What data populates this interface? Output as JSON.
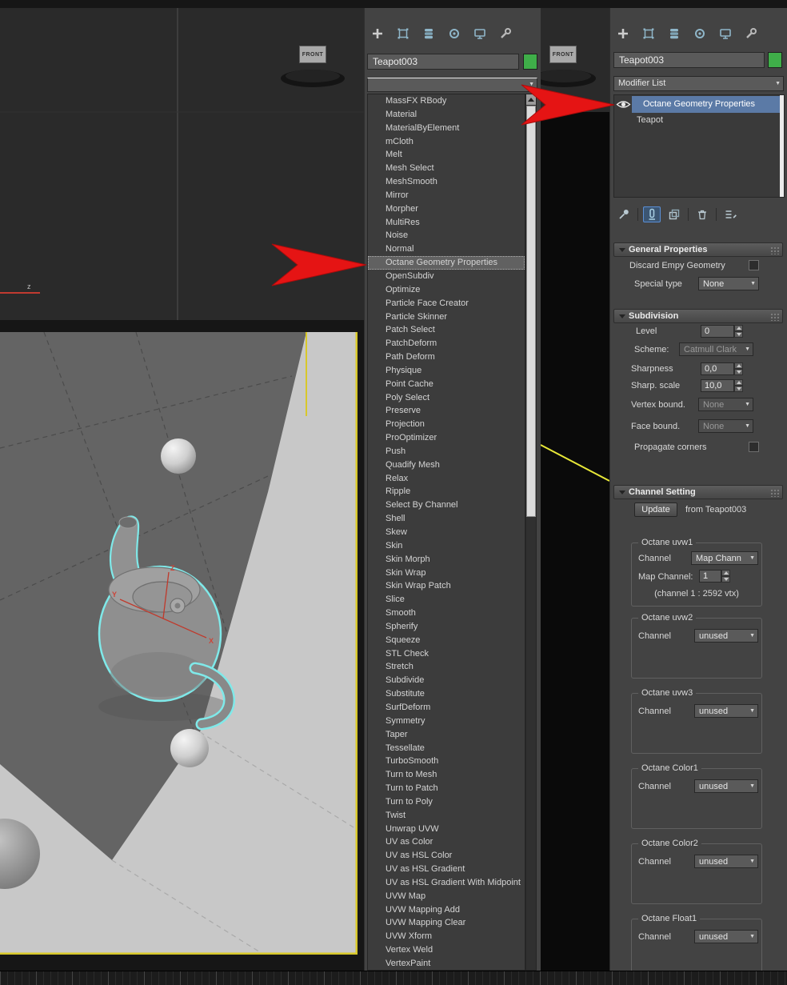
{
  "viewports": {
    "front_label": "FRONT",
    "world_axis_z": "z",
    "gizmo": {
      "x": "X",
      "y": "Y",
      "z": "Z"
    }
  },
  "command_panel": {
    "object_name": "Teapot003",
    "modifier_list_label": "Modifier List",
    "color_swatch": "#3fae49"
  },
  "modifier_dropdown": {
    "selected": "Octane Geometry Properties",
    "items": [
      "MassFX RBody",
      "Material",
      "MaterialByElement",
      "mCloth",
      "Melt",
      "Mesh Select",
      "MeshSmooth",
      "Mirror",
      "Morpher",
      "MultiRes",
      "Noise",
      "Normal",
      "Octane Geometry Properties",
      "OpenSubdiv",
      "Optimize",
      "Particle Face Creator",
      "Particle Skinner",
      "Patch Select",
      "PatchDeform",
      "Path Deform",
      "Physique",
      "Point Cache",
      "Poly Select",
      "Preserve",
      "Projection",
      "ProOptimizer",
      "Push",
      "Quadify Mesh",
      "Relax",
      "Ripple",
      "Select By Channel",
      "Shell",
      "Skew",
      "Skin",
      "Skin Morph",
      "Skin Wrap",
      "Skin Wrap Patch",
      "Slice",
      "Smooth",
      "Spherify",
      "Squeeze",
      "STL Check",
      "Stretch",
      "Subdivide",
      "Substitute",
      "SurfDeform",
      "Symmetry",
      "Taper",
      "Tessellate",
      "TurboSmooth",
      "Turn to Mesh",
      "Turn to Patch",
      "Turn to Poly",
      "Twist",
      "Unwrap UVW",
      "UV as Color",
      "UV as HSL Color",
      "UV as HSL Gradient",
      "UV as HSL Gradient With Midpoint",
      "UVW Map",
      "UVW Mapping Add",
      "UVW Mapping Clear",
      "UVW Xform",
      "Vertex Weld",
      "VertexPaint"
    ]
  },
  "modifier_stack": {
    "items": [
      {
        "label": "Octane Geometry Properties",
        "selected": true
      },
      {
        "label": "Teapot",
        "selected": false
      }
    ]
  },
  "rollouts": {
    "general": {
      "title": "General Properties",
      "discard_label": "Discard Empy Geometry",
      "special_type_label": "Special type",
      "special_type_value": "None"
    },
    "subdivision": {
      "title": "Subdivision",
      "level_label": "Level",
      "level_value": "0",
      "scheme_label": "Scheme:",
      "scheme_value": "Catmull Clark",
      "sharpness_label": "Sharpness",
      "sharpness_value": "0,0",
      "sharp_scale_label": "Sharp. scale",
      "sharp_scale_value": "10,0",
      "vertex_bound_label": "Vertex bound.",
      "vertex_bound_value": "None",
      "face_bound_label": "Face bound.",
      "face_bound_value": "None",
      "propagate_label": "Propagate corners"
    },
    "channel": {
      "title": "Channel Setting",
      "update_button": "Update",
      "from_text": "from Teapot003",
      "groups": [
        {
          "name": "Octane uvw1",
          "channel_label": "Channel",
          "channel_value": "Map Chann",
          "map_channel_label": "Map Channel:",
          "map_channel_value": "1",
          "info": "(channel 1 : 2592 vtx)"
        },
        {
          "name": "Octane uvw2",
          "channel_label": "Channel",
          "channel_value": "unused"
        },
        {
          "name": "Octane uvw3",
          "channel_label": "Channel",
          "channel_value": "unused"
        },
        {
          "name": "Octane Color1",
          "channel_label": "Channel",
          "channel_value": "unused"
        },
        {
          "name": "Octane Color2",
          "channel_label": "Channel",
          "channel_value": "unused"
        },
        {
          "name": "Octane Float1",
          "channel_label": "Channel",
          "channel_value": "unused"
        }
      ]
    }
  },
  "icons": {
    "panel_tabs": [
      "create-icon",
      "modify-icon",
      "hierarchy-icon",
      "motion-icon",
      "display-icon",
      "utilities-icon"
    ],
    "stack_toolbar": [
      "pin-stack-icon",
      "show-end-result-icon",
      "make-unique-icon",
      "remove-modifier-icon",
      "configure-modifier-sets-icon"
    ],
    "visibility": "eye-icon"
  },
  "colors": {
    "stack_selected": "#5b7aa6",
    "swatch_green": "#3fae49",
    "annotation_arrow": "#e51414",
    "active_viewport_border": "#d8c82a"
  }
}
